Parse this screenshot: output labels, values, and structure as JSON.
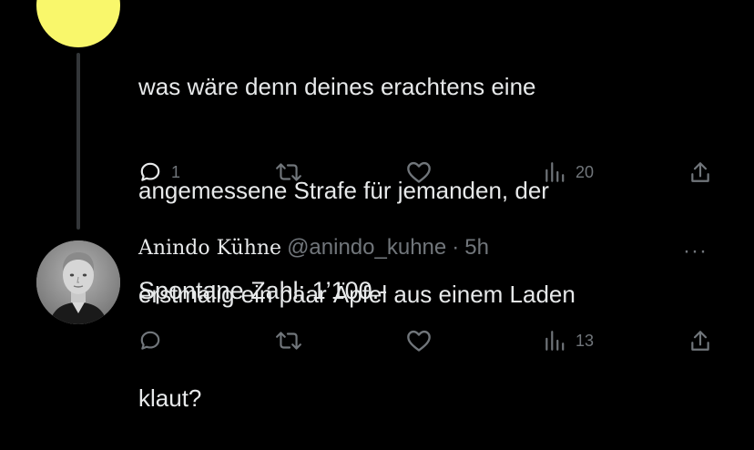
{
  "parent_tweet": {
    "text_lines": [
      "was wäre denn deines erachtens eine",
      "angemessene Strafe für jemanden, der",
      "erstmalig ein paar Äpfel aus einem Laden",
      "klaut?"
    ],
    "actions": {
      "reply_count": "1",
      "retweet_count": "",
      "like_count": "",
      "views_count": "20"
    }
  },
  "reply_tweet": {
    "display_name": "Anindo Kühne",
    "handle": "@anindo_kuhne",
    "separator": "·",
    "time": "5h",
    "more_label": "···",
    "text": "Spontane Zahl: 1’100.-",
    "actions": {
      "reply_count": "",
      "retweet_count": "",
      "like_count": "",
      "views_count": "13"
    }
  },
  "icons": [
    "reply-icon",
    "retweet-icon",
    "like-icon",
    "views-icon",
    "share-icon",
    "more-icon"
  ],
  "colors": {
    "background": "#000000",
    "text": "#e7e9ea",
    "secondary": "#71767b",
    "thread_line": "#333639",
    "avatar_yellow": "#f9f76b"
  }
}
